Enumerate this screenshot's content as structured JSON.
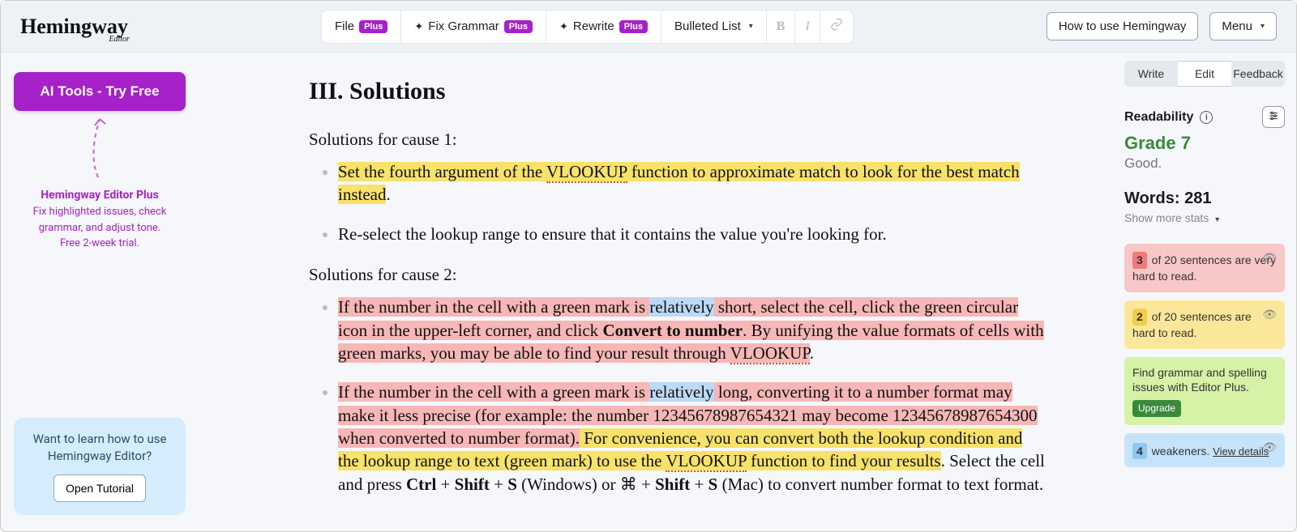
{
  "logo": {
    "main": "Hemingway",
    "sub": "Editor"
  },
  "toolbar": {
    "file": "File",
    "fix_grammar": "Fix Grammar",
    "rewrite": "Rewrite",
    "bulleted_list": "Bulleted List",
    "plus_badge": "Plus"
  },
  "right_buttons": {
    "how_to": "How to use Hemingway",
    "menu": "Menu"
  },
  "left": {
    "ai_button": "AI Tools - Try Free",
    "promo_title": "Hemingway Editor Plus",
    "promo_line1": "Fix highlighted issues, check grammar, and adjust tone.",
    "promo_line2": "Free 2-week trial.",
    "tutorial_text": "Want to learn how to use Hemingway Editor?",
    "tutorial_btn": "Open Tutorial"
  },
  "editor": {
    "heading": "III. Solutions",
    "lead1": "Solutions for cause 1:",
    "li1_a": "Set the fourth argument of the ",
    "li1_vlookup": "VLOOKUP",
    "li1_b": " function to approximate match to look for the best match instead",
    "li1_c": ".",
    "li2": "Re-select the lookup range to ensure that it contains the value you're looking for.",
    "lead2": "Solutions for cause 2:",
    "li3_a": "If the number in the cell with a green mark is ",
    "li3_rel": "relatively",
    "li3_b": " short, select the cell, click the green circular icon in the upper-left corner, and click ",
    "li3_bold": "Convert to number",
    "li3_c": ". By unifying the value formats of cells with green marks, you may be able to find your result through ",
    "li3_vlookup": "VLOOKUP",
    "li3_d": ".",
    "li4_a": "If the number in the cell with a green mark is ",
    "li4_rel": "relatively",
    "li4_b": " long, converting it to a number format may make it less precise (for example: the number 12345678987654321 may become 12345678987654300 when converted to number format).",
    "li4_c": " For convenience, you can convert both the lookup condition and the lookup range to text (green mark) to use the ",
    "li4_vlookup": "VLOOKUP",
    "li4_d": " function to find your results",
    "li4_e": ". Select the cell and press ",
    "li4_k1": "Ctrl",
    "li4_plus1": " + ",
    "li4_k2": "Shift",
    "li4_plus2": " + ",
    "li4_k3": "S",
    "li4_f": " (Windows) or ⌘ + ",
    "li4_k4": "Shift",
    "li4_plus3": " + ",
    "li4_k5": "S",
    "li4_g": " (Mac) to convert number format to text format."
  },
  "sidebar": {
    "tabs": {
      "write": "Write",
      "edit": "Edit",
      "feedback": "Feedback"
    },
    "readability_label": "Readability",
    "grade": "Grade 7",
    "grade_desc": "Good.",
    "words_label": "Words: 281",
    "show_more": "Show more stats",
    "card_red_count": "3",
    "card_red_text": " of 20 sentences are very hard to read.",
    "card_yellow_count": "2",
    "card_yellow_text": " of 20 sentences are hard to read.",
    "card_green_text": "Find grammar and spelling issues with Editor Plus.",
    "upgrade": "Upgrade",
    "card_blue_count": "4",
    "card_blue_text": " weakeners.",
    "view_details": "View details"
  }
}
